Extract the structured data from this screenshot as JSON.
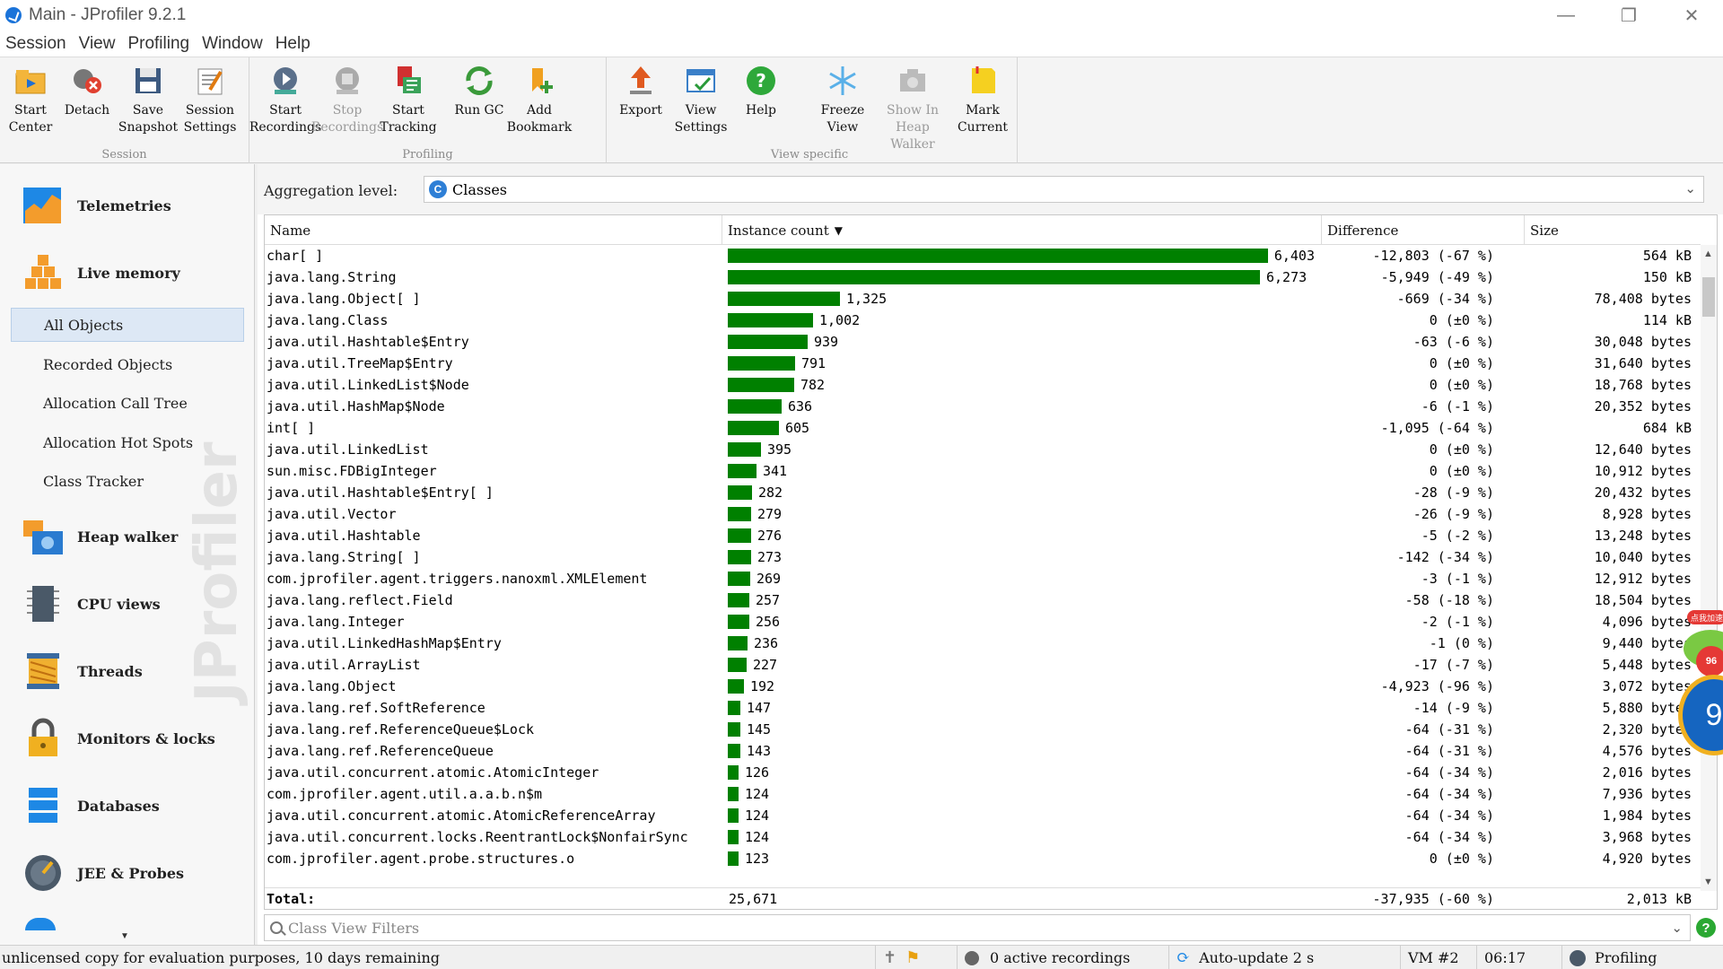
{
  "window": {
    "title": "Main - JProfiler 9.2.1"
  },
  "menubar": [
    "Session",
    "View",
    "Profiling",
    "Window",
    "Help"
  ],
  "toolbar": {
    "groups": [
      {
        "label": "Session",
        "buttons": [
          {
            "label": "Start\nCenter",
            "icon": "start-center-icon"
          },
          {
            "label": "Detach",
            "icon": "detach-icon"
          },
          {
            "label": "Save\nSnapshot",
            "icon": "save-snapshot-icon"
          },
          {
            "label": "Session\nSettings",
            "icon": "session-settings-icon"
          }
        ]
      },
      {
        "label": "Profiling",
        "buttons": [
          {
            "label": "Start\nRecordings",
            "icon": "start-recordings-icon"
          },
          {
            "label": "Stop\nRecordings",
            "icon": "stop-recordings-icon",
            "disabled": true
          },
          {
            "label": "Start\nTracking",
            "icon": "start-tracking-icon"
          },
          {
            "label": "Run GC",
            "icon": "run-gc-icon"
          },
          {
            "label": "Add\nBookmark",
            "icon": "add-bookmark-icon"
          }
        ]
      },
      {
        "label": "",
        "buttons": [
          {
            "label": "Export",
            "icon": "export-icon"
          },
          {
            "label": "View\nSettings",
            "icon": "view-settings-icon"
          },
          {
            "label": "Help",
            "icon": "help-icon"
          }
        ]
      },
      {
        "label": "View specific",
        "buttons": [
          {
            "label": "Freeze\nView",
            "icon": "freeze-view-icon"
          },
          {
            "label": "Show In\nHeap Walker",
            "icon": "show-in-heap-walker-icon",
            "disabled": true
          },
          {
            "label": "Mark\nCurrent",
            "icon": "mark-current-icon"
          }
        ]
      }
    ]
  },
  "sidebar": {
    "main_items": [
      {
        "label": "Telemetries",
        "icon": "telemetries-icon"
      },
      {
        "label": "Live memory",
        "icon": "live-memory-icon"
      },
      {
        "label": "Heap walker",
        "icon": "heap-walker-icon"
      },
      {
        "label": "CPU views",
        "icon": "cpu-views-icon"
      },
      {
        "label": "Threads",
        "icon": "threads-icon"
      },
      {
        "label": "Monitors & locks",
        "icon": "monitors-locks-icon"
      },
      {
        "label": "Databases",
        "icon": "databases-icon"
      },
      {
        "label": "JEE & Probes",
        "icon": "jee-probes-icon"
      }
    ],
    "sub_items": [
      {
        "label": "All Objects",
        "selected": true
      },
      {
        "label": "Recorded Objects"
      },
      {
        "label": "Allocation Call Tree"
      },
      {
        "label": "Allocation Hot Spots"
      },
      {
        "label": "Class Tracker"
      }
    ],
    "watermark": "JProfiler"
  },
  "aggregation": {
    "label": "Aggregation level:",
    "value": "Classes"
  },
  "table": {
    "columns": [
      "Name",
      "Instance count",
      "Difference",
      "Size"
    ],
    "sort_indicator": "▼",
    "max_count": 6403,
    "rows": [
      {
        "name": "char[ ]",
        "count": 6403,
        "count_text": "6,403",
        "diff": "-12,803 (-67 %)",
        "size": "564 kB"
      },
      {
        "name": "java.lang.String",
        "count": 6273,
        "count_text": "6,273",
        "diff": "-5,949 (-49 %)",
        "size": "150 kB"
      },
      {
        "name": "java.lang.Object[ ]",
        "count": 1325,
        "count_text": "1,325",
        "diff": "-669 (-34 %)",
        "size": "78,408 bytes"
      },
      {
        "name": "java.lang.Class",
        "count": 1002,
        "count_text": "1,002",
        "diff": "0 (±0 %)",
        "size": "114 kB"
      },
      {
        "name": "java.util.Hashtable$Entry",
        "count": 939,
        "count_text": "939",
        "diff": "-63 (-6 %)",
        "size": "30,048 bytes"
      },
      {
        "name": "java.util.TreeMap$Entry",
        "count": 791,
        "count_text": "791",
        "diff": "0 (±0 %)",
        "size": "31,640 bytes"
      },
      {
        "name": "java.util.LinkedList$Node",
        "count": 782,
        "count_text": "782",
        "diff": "0 (±0 %)",
        "size": "18,768 bytes"
      },
      {
        "name": "java.util.HashMap$Node",
        "count": 636,
        "count_text": "636",
        "diff": "-6 (-1 %)",
        "size": "20,352 bytes"
      },
      {
        "name": "int[ ]",
        "count": 605,
        "count_text": "605",
        "diff": "-1,095 (-64 %)",
        "size": "684 kB"
      },
      {
        "name": "java.util.LinkedList",
        "count": 395,
        "count_text": "395",
        "diff": "0 (±0 %)",
        "size": "12,640 bytes"
      },
      {
        "name": "sun.misc.FDBigInteger",
        "count": 341,
        "count_text": "341",
        "diff": "0 (±0 %)",
        "size": "10,912 bytes"
      },
      {
        "name": "java.util.Hashtable$Entry[ ]",
        "count": 282,
        "count_text": "282",
        "diff": "-28 (-9 %)",
        "size": "20,432 bytes"
      },
      {
        "name": "java.util.Vector",
        "count": 279,
        "count_text": "279",
        "diff": "-26 (-9 %)",
        "size": "8,928 bytes"
      },
      {
        "name": "java.util.Hashtable",
        "count": 276,
        "count_text": "276",
        "diff": "-5 (-2 %)",
        "size": "13,248 bytes"
      },
      {
        "name": "java.lang.String[ ]",
        "count": 273,
        "count_text": "273",
        "diff": "-142 (-34 %)",
        "size": "10,040 bytes"
      },
      {
        "name": "com.jprofiler.agent.triggers.nanoxml.XMLElement",
        "count": 269,
        "count_text": "269",
        "diff": "-3 (-1 %)",
        "size": "12,912 bytes"
      },
      {
        "name": "java.lang.reflect.Field",
        "count": 257,
        "count_text": "257",
        "diff": "-58 (-18 %)",
        "size": "18,504 bytes"
      },
      {
        "name": "java.lang.Integer",
        "count": 256,
        "count_text": "256",
        "diff": "-2 (-1 %)",
        "size": "4,096 bytes"
      },
      {
        "name": "java.util.LinkedHashMap$Entry",
        "count": 236,
        "count_text": "236",
        "diff": "-1 (0 %)",
        "size": "9,440 bytes"
      },
      {
        "name": "java.util.ArrayList",
        "count": 227,
        "count_text": "227",
        "diff": "-17 (-7 %)",
        "size": "5,448 bytes"
      },
      {
        "name": "java.lang.Object",
        "count": 192,
        "count_text": "192",
        "diff": "-4,923 (-96 %)",
        "size": "3,072 bytes"
      },
      {
        "name": "java.lang.ref.SoftReference",
        "count": 147,
        "count_text": "147",
        "diff": "-14 (-9 %)",
        "size": "5,880 bytes"
      },
      {
        "name": "java.lang.ref.ReferenceQueue$Lock",
        "count": 145,
        "count_text": "145",
        "diff": "-64 (-31 %)",
        "size": "2,320 bytes"
      },
      {
        "name": "java.lang.ref.ReferenceQueue",
        "count": 143,
        "count_text": "143",
        "diff": "-64 (-31 %)",
        "size": "4,576 bytes"
      },
      {
        "name": "java.util.concurrent.atomic.AtomicInteger",
        "count": 126,
        "count_text": "126",
        "diff": "-64 (-34 %)",
        "size": "2,016 bytes"
      },
      {
        "name": "com.jprofiler.agent.util.a.a.b.n$m",
        "count": 124,
        "count_text": "124",
        "diff": "-64 (-34 %)",
        "size": "7,936 bytes"
      },
      {
        "name": "java.util.concurrent.atomic.AtomicReferenceArray",
        "count": 124,
        "count_text": "124",
        "diff": "-64 (-34 %)",
        "size": "1,984 bytes"
      },
      {
        "name": "java.util.concurrent.locks.ReentrantLock$NonfairSync",
        "count": 124,
        "count_text": "124",
        "diff": "-64 (-34 %)",
        "size": "3,968 bytes"
      },
      {
        "name": "com.jprofiler.agent.probe.structures.o",
        "count": 123,
        "count_text": "123",
        "diff": "0 (±0 %)",
        "size": "4,920 bytes"
      }
    ],
    "total": {
      "label": "Total:",
      "count": "25,671",
      "diff": "-37,935 (-60 %)",
      "size": "2,013 kB"
    }
  },
  "filter": {
    "placeholder": "Class View Filters"
  },
  "statusbar": {
    "license": "unlicensed copy for evaluation purposes, 10 days remaining",
    "recordings": "0 active recordings",
    "autoupdate": "Auto-update 2 s",
    "vm": "VM #2",
    "time": "06:17",
    "mode": "Profiling"
  },
  "widget": {
    "text": "点我加速",
    "badge": "96",
    "number": "9"
  },
  "colors": {
    "bar": "#008000",
    "selection": "#dde8f5",
    "accent": "#2e7fd6"
  }
}
